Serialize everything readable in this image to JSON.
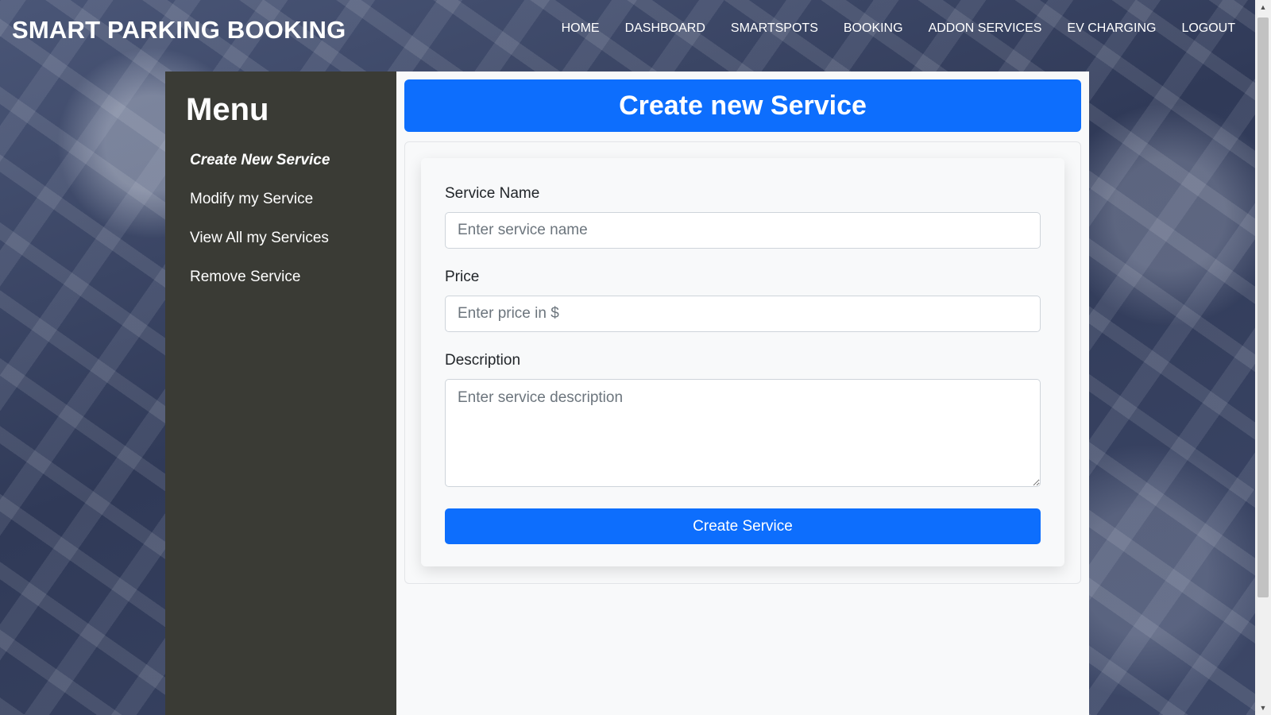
{
  "brand": "SMART PARKING BOOKING",
  "nav": [
    "HOME",
    "DASHBOARD",
    "SMARTSPOTS",
    "BOOKING",
    "ADDON SERVICES",
    "EV CHARGING",
    "LOGOUT"
  ],
  "sidebar": {
    "title": "Menu",
    "items": [
      {
        "label": "Create New Service",
        "active": true
      },
      {
        "label": "Modify my Service"
      },
      {
        "label": "View All my Services"
      },
      {
        "label": "Remove Service"
      }
    ]
  },
  "page": {
    "title": "Create new Service"
  },
  "form": {
    "service_name_label": "Service Name",
    "service_name_placeholder": "Enter service name",
    "price_label": "Price",
    "price_placeholder": "Enter price in $",
    "description_label": "Description",
    "description_placeholder": "Enter service description",
    "submit_label": "Create Service"
  },
  "colors": {
    "primary": "#0d6efd",
    "sidebar_bg": "#3a3b35",
    "content_bg": "#f8f9fa"
  },
  "icons": {
    "scroll_up": "triangle-up-icon",
    "scroll_down": "triangle-down-icon"
  }
}
